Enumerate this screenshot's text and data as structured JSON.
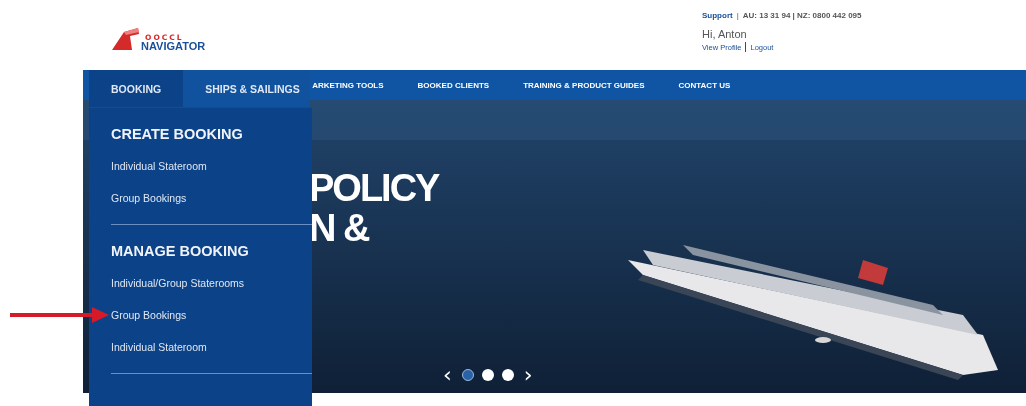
{
  "logo": {
    "small_text": "OOCCL",
    "name": "NAVIGATOR"
  },
  "support": {
    "label": "Support",
    "separator": "|",
    "phones": "AU: 13 31 94 | NZ: 0800 442 095"
  },
  "user": {
    "greeting": "Hi, Anton",
    "links": [
      "View Profile",
      "Logout"
    ]
  },
  "nav": [
    {
      "label": "BOOKING",
      "selected": true
    },
    {
      "label": "SHIPS & SAILINGS",
      "selected": false
    },
    {
      "label": "ARKETING TOOLS",
      "selected": false
    },
    {
      "label": "BOOKED CLIENTS",
      "selected": false
    },
    {
      "label": "TRAINING & PRODUCT GUIDES",
      "selected": false
    },
    {
      "label": "CONTACT US",
      "selected": false
    }
  ],
  "dropdown": [
    {
      "heading": "CREATE BOOKING",
      "items": [
        {
          "label": "Individual Stateroom",
          "annotated": false
        },
        {
          "label": "Group Bookings",
          "annotated": false
        }
      ]
    },
    {
      "heading": "MANAGE BOOKING",
      "items": [
        {
          "label": "Individual/Group Staterooms",
          "annotated": false
        },
        {
          "label": "Group Bookings",
          "annotated": true
        },
        {
          "label": "Individual Stateroom",
          "annotated": false
        }
      ]
    }
  ],
  "hero": {
    "lines": [
      "POLICY",
      "N &"
    ],
    "slides": [
      {
        "selected": true
      },
      {
        "selected": false
      },
      {
        "selected": false
      }
    ],
    "prev": "‹",
    "next": "›"
  }
}
